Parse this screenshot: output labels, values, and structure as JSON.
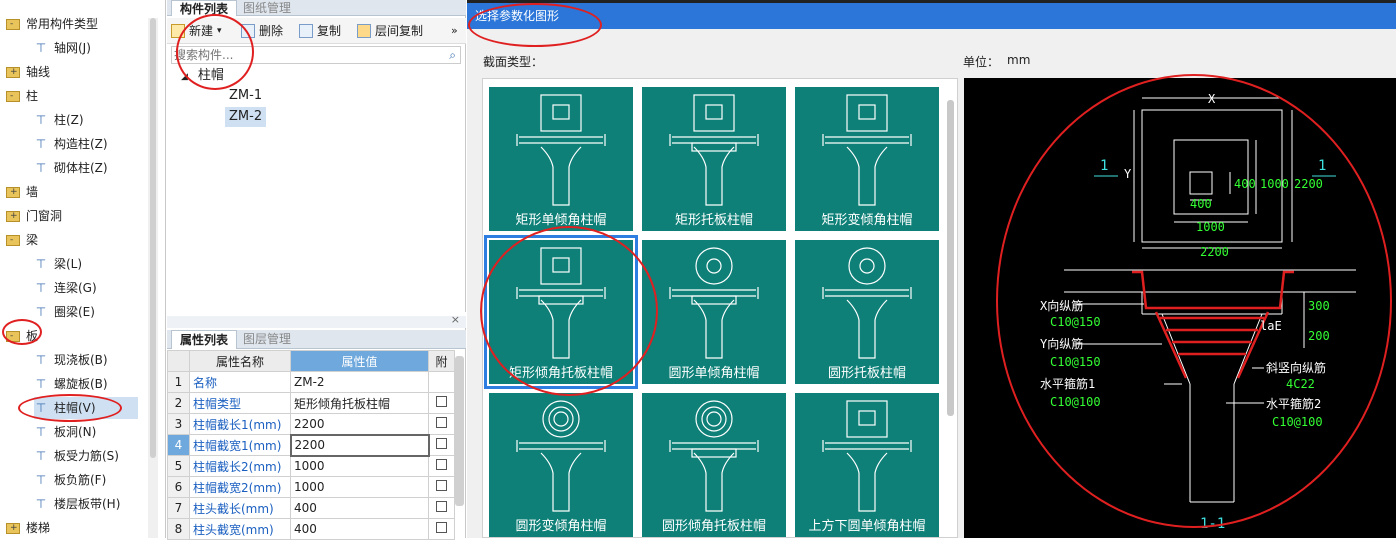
{
  "tree": {
    "items": [
      {
        "label": "常用构件类型",
        "kind": "folder",
        "pm": "-"
      },
      {
        "label": "轴网(J)",
        "kind": "leaf",
        "icon": "grid-icon"
      },
      {
        "label": "轴线",
        "kind": "folder",
        "pm": "+"
      },
      {
        "label": "柱",
        "kind": "folder",
        "pm": "-"
      },
      {
        "label": "柱(Z)",
        "kind": "leaf",
        "icon": "column-icon"
      },
      {
        "label": "构造柱(Z)",
        "kind": "leaf",
        "icon": "constructional-column-icon"
      },
      {
        "label": "砌体柱(Z)",
        "kind": "leaf",
        "icon": "masonry-column-icon"
      },
      {
        "label": "墙",
        "kind": "folder",
        "pm": "+"
      },
      {
        "label": "门窗洞",
        "kind": "folder",
        "pm": "+"
      },
      {
        "label": "梁",
        "kind": "folder",
        "pm": "-"
      },
      {
        "label": "梁(L)",
        "kind": "leaf",
        "icon": "beam-icon"
      },
      {
        "label": "连梁(G)",
        "kind": "leaf",
        "icon": "coupling-beam-icon"
      },
      {
        "label": "圈梁(E)",
        "kind": "leaf",
        "icon": "ring-beam-icon"
      },
      {
        "label": "板",
        "kind": "folder",
        "pm": "-"
      },
      {
        "label": "现浇板(B)",
        "kind": "leaf",
        "icon": "cast-slab-icon"
      },
      {
        "label": "螺旋板(B)",
        "kind": "leaf",
        "icon": "spiral-slab-icon"
      },
      {
        "label": "柱帽(V)",
        "kind": "leaf",
        "icon": "column-cap-icon",
        "selected": true
      },
      {
        "label": "板洞(N)",
        "kind": "leaf",
        "icon": "slab-hole-icon"
      },
      {
        "label": "板受力筋(S)",
        "kind": "leaf",
        "icon": "slab-rebar-icon"
      },
      {
        "label": "板负筋(F)",
        "kind": "leaf",
        "icon": "slab-negative-rebar-icon"
      },
      {
        "label": "楼层板带(H)",
        "kind": "leaf",
        "icon": "floor-band-icon"
      },
      {
        "label": "楼梯",
        "kind": "folder",
        "pm": "+"
      }
    ]
  },
  "component_panel": {
    "tabs": [
      "构件列表",
      "图纸管理"
    ],
    "toolbar": {
      "new": "新建",
      "delete": "删除",
      "copy": "复制",
      "floor_copy": "层间复制",
      "more": "»"
    },
    "search_placeholder": "搜索构件...",
    "root": "柱帽",
    "children": [
      "ZM-1",
      "ZM-2"
    ]
  },
  "property_panel": {
    "tabs": [
      "属性列表",
      "图层管理"
    ],
    "close": "×",
    "headers": [
      "属性名称",
      "属性值",
      "附"
    ],
    "rows": [
      {
        "no": "1",
        "name": "名称",
        "value": "ZM-2",
        "check": false
      },
      {
        "no": "2",
        "name": "柱帽类型",
        "value": "矩形倾角托板柱帽",
        "check": true
      },
      {
        "no": "3",
        "name": "柱帽截长1(mm)",
        "value": "2200",
        "check": true
      },
      {
        "no": "4",
        "name": "柱帽截宽1(mm)",
        "value": "2200",
        "check": true
      },
      {
        "no": "5",
        "name": "柱帽截长2(mm)",
        "value": "1000",
        "check": true
      },
      {
        "no": "6",
        "name": "柱帽截宽2(mm)",
        "value": "1000",
        "check": true
      },
      {
        "no": "7",
        "name": "柱头截长(mm)",
        "value": "400",
        "check": true
      },
      {
        "no": "8",
        "name": "柱头截宽(mm)",
        "value": "400",
        "check": true
      }
    ]
  },
  "dialog": {
    "title": "选择参数化图形",
    "section_label": "截面类型：",
    "unit_label": "单位：",
    "unit_value": "mm",
    "shapes": [
      "矩形单倾角柱帽",
      "矩形托板柱帽",
      "矩形变倾角柱帽",
      "矩形倾角托板柱帽",
      "圆形单倾角柱帽",
      "圆形托板柱帽",
      "圆形变倾角柱帽",
      "圆形倾角托板柱帽",
      "上方下圆单倾角柱帽"
    ],
    "selected_shape": "矩形倾角托板柱帽",
    "preview": {
      "dim_x": "X",
      "dim_y": "Y",
      "d1000a": "1000",
      "d2200a": "2200",
      "d400a": "400",
      "d400b": "400",
      "d1000b": "1000",
      "d2200b": "2200",
      "sec_left": "1",
      "sec_right": "1",
      "d300": "300",
      "d200": "200",
      "lae": "laE",
      "x_rebar": "X向纵筋",
      "x_rebar_spec": "C10@150",
      "y_rebar": "Y向纵筋",
      "y_rebar_spec": "C10@150",
      "hoop1": "水平箍筋1",
      "hoop1_spec": "C10@100",
      "slant": "斜竖向纵筋",
      "slant_spec": "4C22",
      "hoop2": "水平箍筋2",
      "hoop2_spec": "C10@100",
      "section": "1-1"
    }
  },
  "colors": {
    "teal": "#0e8078",
    "title_blue": "#2b76d8",
    "annotation_red": "#e02020",
    "cad_green": "#33ff33",
    "cad_cyan": "#3fe0e0"
  }
}
